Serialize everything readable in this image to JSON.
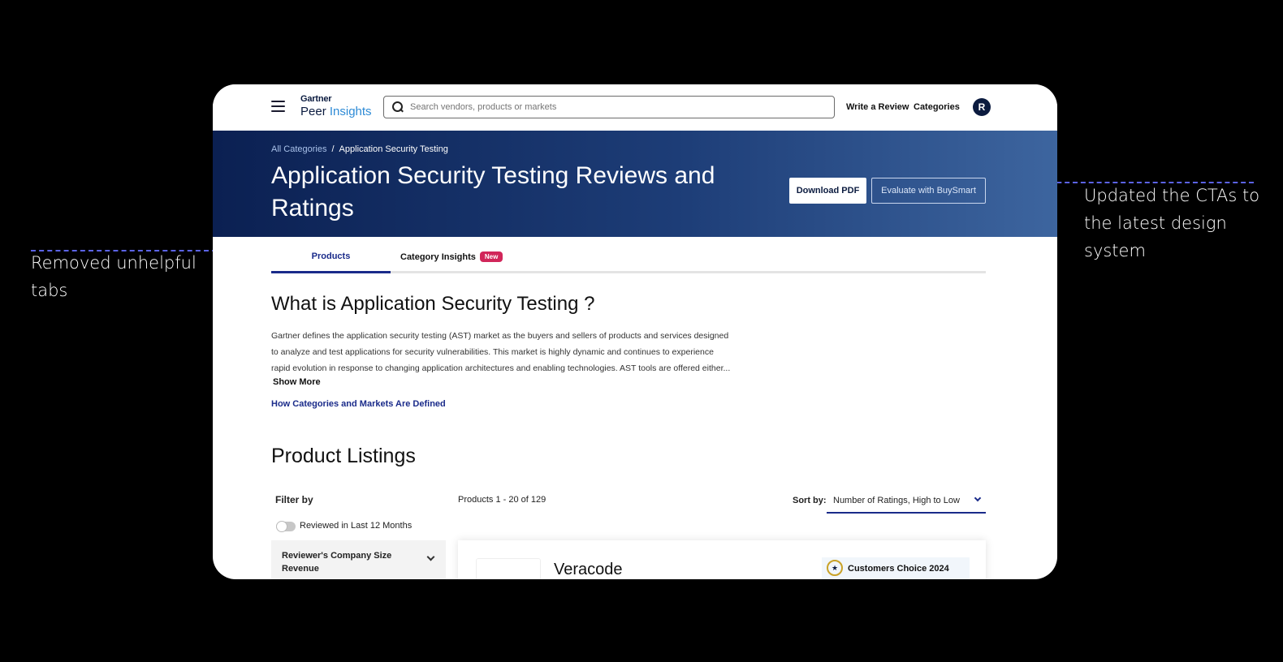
{
  "annotations": {
    "left": "Removed unhelpful tabs",
    "right": "Updated the CTAs to the latest design system"
  },
  "header": {
    "logo_top": "Gartner",
    "logo_peer": "Peer",
    "logo_insights": "Insights",
    "search_placeholder": "Search vendors, products or markets",
    "write_review": "Write a Review",
    "categories": "Categories",
    "avatar_initial": "R"
  },
  "hero": {
    "breadcrumb_root": "All Categories",
    "breadcrumb_sep": "/",
    "breadcrumb_current": "Application Security Testing",
    "title": "Application Security Testing Reviews and Ratings",
    "download_pdf": "Download PDF",
    "evaluate": "Evaluate with BuySmart"
  },
  "tabs": {
    "products": "Products",
    "insights": "Category Insights",
    "new_badge": "New"
  },
  "about": {
    "title": "What is Application Security Testing ?",
    "lines": [
      "Gartner defines the application security testing (AST) market as the buyers and sellers of products and services designed",
      "to analyze and test applications for security vulnerabilities. This market is highly dynamic and continues to experience",
      "rapid evolution in response to changing application architectures and enabling technologies. AST tools are offered either..."
    ],
    "show_more": "Show More",
    "how_link": "How Categories and Markets Are Defined"
  },
  "listings": {
    "title": "Product Listings",
    "filter_by": "Filter by",
    "toggle_label": "Reviewed in Last 12 Months",
    "filter_panel_label": "Reviewer's Company Size Revenue",
    "products_count": "Products 1 - 20 of 129",
    "sort_label": "Sort by:",
    "sort_value": "Number of Ratings, High to Low",
    "first_product": {
      "name": "Veracode",
      "badge": "Customers Choice 2024"
    }
  }
}
